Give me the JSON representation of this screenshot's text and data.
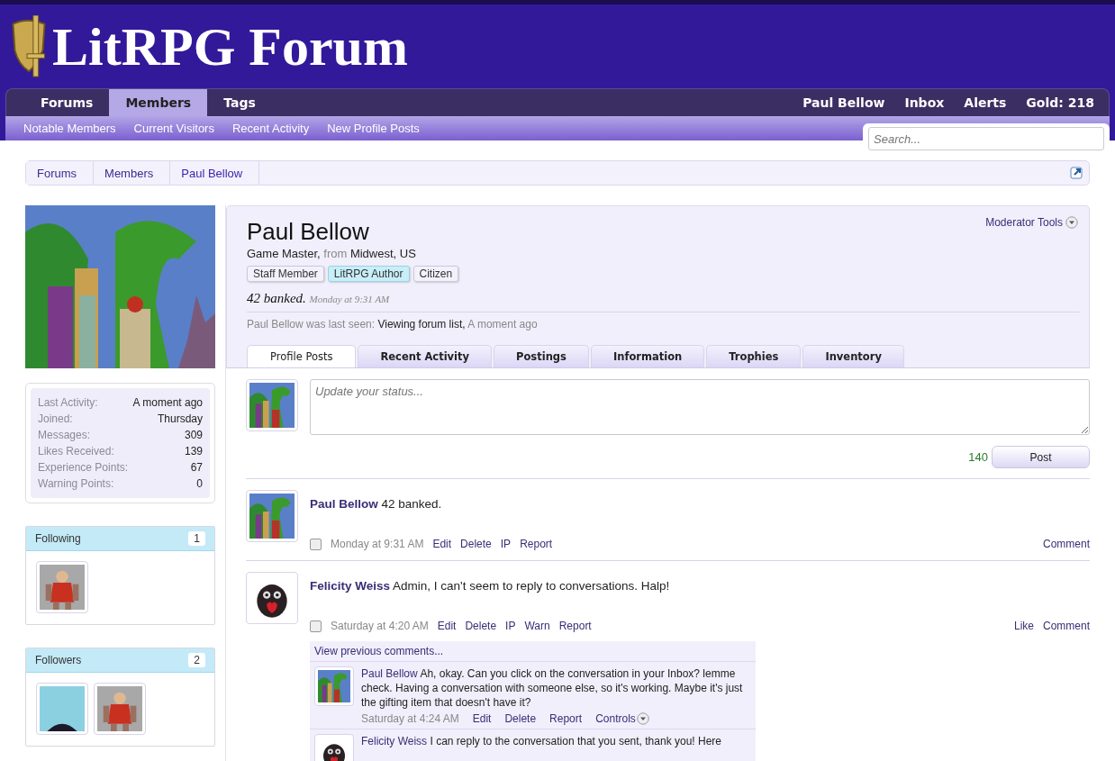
{
  "site": {
    "logo_text": "LitRPG Forum"
  },
  "nav": {
    "tabs": [
      {
        "label": "Forums",
        "selected": false
      },
      {
        "label": "Members",
        "selected": true
      },
      {
        "label": "Tags",
        "selected": false
      }
    ],
    "user_links": [
      "Paul Bellow",
      "Inbox",
      "Alerts",
      "Gold: 218"
    ],
    "sub_links": [
      "Notable Members",
      "Current Visitors",
      "Recent Activity",
      "New Profile Posts"
    ],
    "search": {
      "placeholder": "Search..."
    }
  },
  "breadcrumb": [
    "Forums",
    "Members",
    "Paul Bellow"
  ],
  "sidebar": {
    "stats": [
      {
        "label": "Last Activity:",
        "value": "A moment ago"
      },
      {
        "label": "Joined:",
        "value": "Thursday"
      },
      {
        "label": "Messages:",
        "value": "309"
      },
      {
        "label": "Likes Received:",
        "value": "139"
      },
      {
        "label": "Experience Points:",
        "value": "67"
      },
      {
        "label": "Warning Points:",
        "value": "0"
      }
    ],
    "groups": [
      {
        "title": "Following",
        "count": "1",
        "avatars": [
          {
            "kind": "cartoon"
          }
        ]
      },
      {
        "title": "Followers",
        "count": "2",
        "avatars": [
          {
            "kind": "photo"
          },
          {
            "kind": "cartoon"
          }
        ]
      }
    ]
  },
  "profile": {
    "name": "Paul Bellow",
    "title": "Game Master,",
    "from_label": "from",
    "location": "Midwest, US",
    "moderator_tools": "Moderator Tools",
    "banners": [
      {
        "label": "Staff Member",
        "highlighted": false
      },
      {
        "label": "LitRPG Author",
        "highlighted": true
      },
      {
        "label": "Citizen",
        "highlighted": false
      }
    ],
    "status": "42 banked.",
    "status_time": "Monday at 9:31 AM",
    "last_seen": {
      "prefix": "Paul Bellow was last seen:",
      "activity": "Viewing forum list,",
      "time": "A moment ago"
    },
    "tabs": [
      {
        "label": "Profile Posts",
        "selected": true
      },
      {
        "label": "Recent Activity",
        "selected": false
      },
      {
        "label": "Postings",
        "selected": false
      },
      {
        "label": "Information",
        "selected": false
      },
      {
        "label": "Trophies",
        "selected": false
      },
      {
        "label": "Inventory",
        "selected": false
      }
    ]
  },
  "status_update": {
    "placeholder": "Update your status...",
    "counter": "140",
    "button": "Post"
  },
  "posts": [
    {
      "author": "Paul Bellow",
      "avatar": {
        "kind": "dragon"
      },
      "text": "42 banked.",
      "checked": false,
      "time": "Monday at 9:31 AM",
      "actions": [
        "Edit",
        "Delete",
        "IP",
        "Report"
      ],
      "right_actions": [
        "Comment"
      ]
    },
    {
      "author": "Felicity Weiss",
      "avatar": {
        "kind": "owl"
      },
      "text": "Admin, I can't seem to reply to conversations. Halp!",
      "checked": false,
      "time": "Saturday at 4:20 AM",
      "actions": [
        "Edit",
        "Delete",
        "IP",
        "Warn",
        "Report"
      ],
      "right_actions": [
        "Like",
        "Comment"
      ],
      "view_previous": "View previous comments...",
      "comments": [
        {
          "author": "Paul Bellow",
          "avatar": {
            "kind": "dragon"
          },
          "text": "Ah, okay. Can you click on the conversation in your Inbox? lemme check. Having a conversation with someone else, so it's working. Maybe it's just the gifting item that doesn't have it?",
          "time": "Saturday at 4:24 AM",
          "actions": [
            "Edit",
            "Delete",
            "Report"
          ],
          "controls": "Controls"
        },
        {
          "author": "Felicity Weiss",
          "avatar": {
            "kind": "owl"
          },
          "text": "I can reply to the conversation that you sent, thank you! Here"
        }
      ]
    }
  ]
}
